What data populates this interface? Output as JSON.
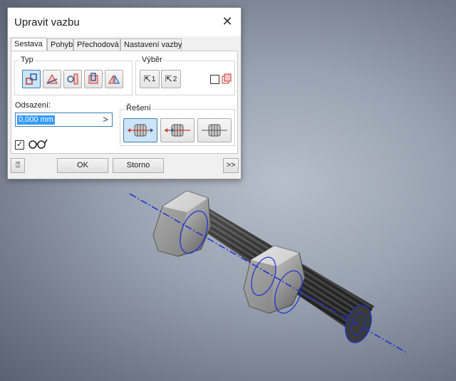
{
  "dialog": {
    "title": "Upravit vazbu",
    "tabs": [
      {
        "label": "Sestava",
        "active": true
      },
      {
        "label": "Pohyb"
      },
      {
        "label": "Přechodová"
      },
      {
        "label": "Nastavení vazby"
      }
    ],
    "type_group": {
      "label": "Typ",
      "icons": [
        "mate-icon",
        "angle-icon",
        "tangent-icon",
        "insert-icon",
        "symmetry-icon"
      ],
      "selected": 0
    },
    "selection_group": {
      "label": "Výběr",
      "buttons": [
        {
          "icon": "select-cursor-icon",
          "label": "1"
        },
        {
          "icon": "select-cursor-icon",
          "label": "2"
        }
      ],
      "first_selection_checkbox": false
    },
    "offset": {
      "label": "Odsazení:",
      "value": "0,000 mm",
      "arrow": ">"
    },
    "solution_group": {
      "label": "Řešení",
      "icons": [
        "mate-solution-icon",
        "flush-solution-icon",
        "undirected-solution-icon"
      ],
      "selected": 0
    },
    "preview_checkbox": {
      "checked": true,
      "icon": "glasses-icon"
    },
    "footer": {
      "help_icon": "help-icon",
      "ok_label": "OK",
      "cancel_label": "Storno",
      "more_label": ">>"
    }
  },
  "colors": {
    "accent": "#3c7fb1",
    "axis_line": "#1a2fd6",
    "highlight": "#3399ff"
  }
}
